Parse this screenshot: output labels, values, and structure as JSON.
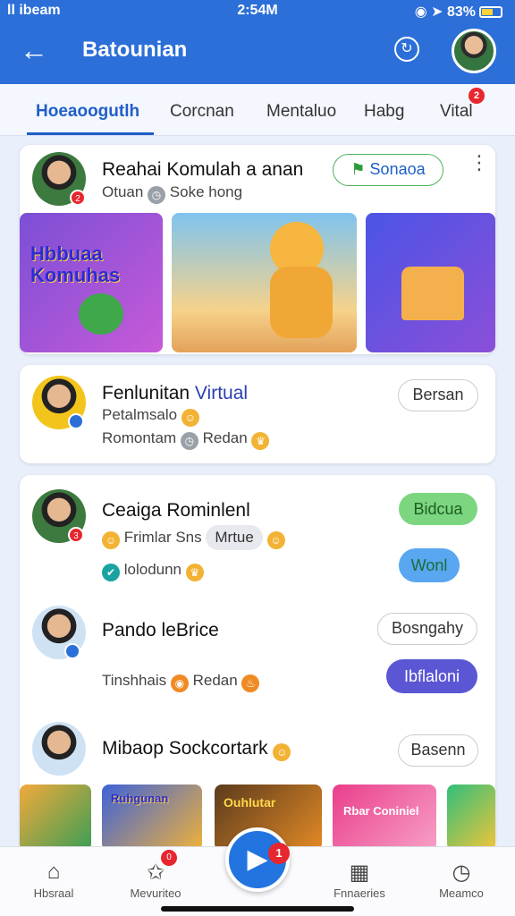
{
  "status_bar": {
    "carrier": "ll ibeam",
    "time": "2:54M",
    "battery": "83%"
  },
  "header": {
    "title": "Batounian"
  },
  "tabs": [
    {
      "label": "Hoeaoogutlh",
      "active": true
    },
    {
      "label": "Corcnan"
    },
    {
      "label": "Mentaluo"
    },
    {
      "label": "Habg"
    },
    {
      "label": "Vital",
      "badge": "2"
    }
  ],
  "card1": {
    "name": "Reahai Komulah a anan",
    "meta_left": "Otuan",
    "meta_right": "Soke hong",
    "follow_label": "Sonaoa",
    "badge": "2",
    "thumb1_title": "Hbbuaa Komuhas"
  },
  "card2": {
    "name": "Fenlunitan",
    "name_highlight": "Virtual",
    "line1": "Petalmsalo",
    "line2_left": "Romontam",
    "line2_right": "Redan",
    "button": "Bersan"
  },
  "card3": {
    "row1": {
      "name": "Ceaiga Rominlenl",
      "badge": "3",
      "meta": "Frimlar Sns",
      "chip": "Mrtue",
      "line2": "lolodunn",
      "button1": "Bidcua",
      "button2": "Wonl"
    },
    "row2": {
      "name": "Pando leBrice",
      "meta_left": "Tinshhais",
      "meta_right": "Redan",
      "button1": "Bosngahy",
      "button2": "Ibflaloni"
    },
    "row3": {
      "name": "Mibaop Sockcortark",
      "button": "Basenn"
    },
    "thumb_titles": [
      "Ruhgunan",
      "Ouhlutar",
      "Rbar Coniniel"
    ]
  },
  "bottom_nav": {
    "items": [
      {
        "label": "Hbsraal",
        "icon": "home-icon"
      },
      {
        "label": "Mevuriteo",
        "icon": "star-icon",
        "badge": "0"
      },
      {
        "label": "Fnnaeries",
        "icon": "calendar-icon"
      },
      {
        "label": "Meamco",
        "icon": "clock-icon"
      }
    ],
    "fab_badge": "1"
  },
  "colors": {
    "primary": "#2c6fd8",
    "accent_red": "#e8262e",
    "purple": "#5a56d4",
    "green": "#7bd67f"
  }
}
